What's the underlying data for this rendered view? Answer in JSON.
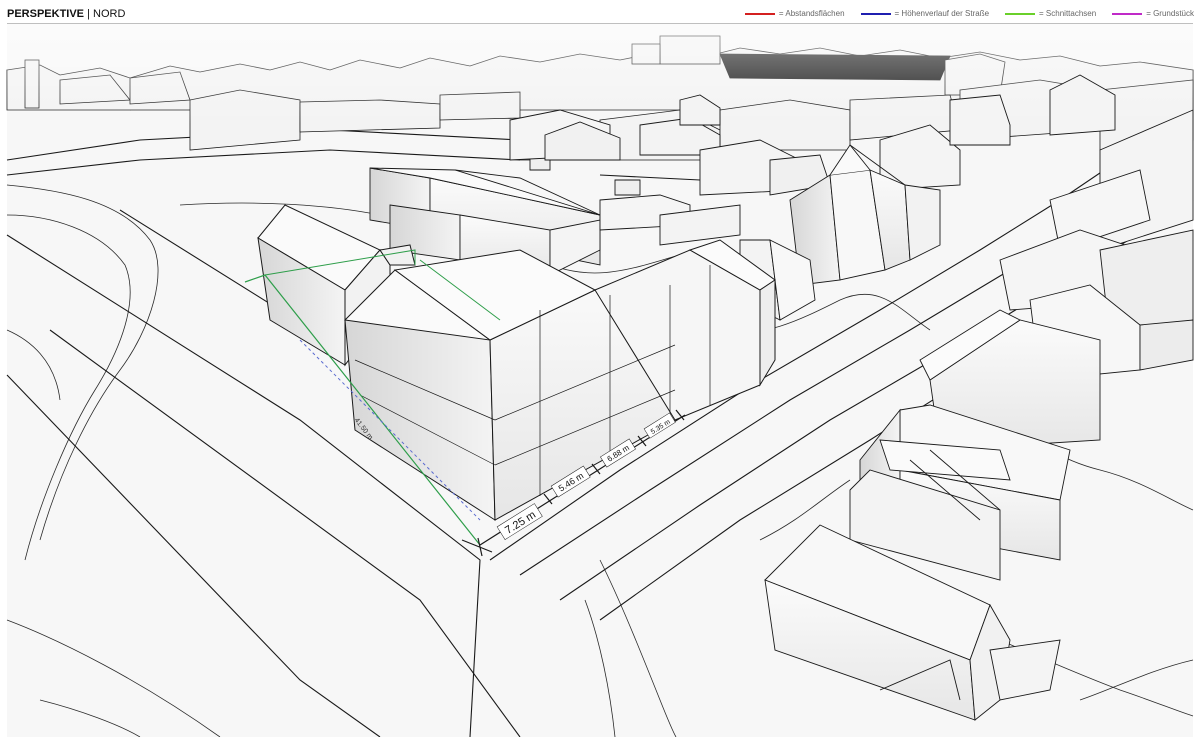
{
  "header": {
    "title_bold": "PERSPEKTIVE",
    "separator": " | ",
    "title_rest": "NORD"
  },
  "legend": [
    {
      "label": "= Abstandsflächen",
      "color": "#d42020"
    },
    {
      "label": "= Höhenverlauf der Straße",
      "color": "#1f1fb0"
    },
    {
      "label": "= Schnittachsen",
      "color": "#6ad02a"
    },
    {
      "label": "= Grundstück",
      "color": "#c02ac8"
    }
  ],
  "dimensions": {
    "front_1": "7.25 m",
    "front_2": "5.46 m",
    "front_3": "6.88 m",
    "front_4": "5.35 m",
    "side": "41.50 m"
  },
  "colors": {
    "building_face": "#f6f6f6",
    "building_shade": "#e2e2e2",
    "outline": "#1a1a1a",
    "setback_line": "#2e9e4a",
    "street_height_line": "#5a6ad0"
  }
}
